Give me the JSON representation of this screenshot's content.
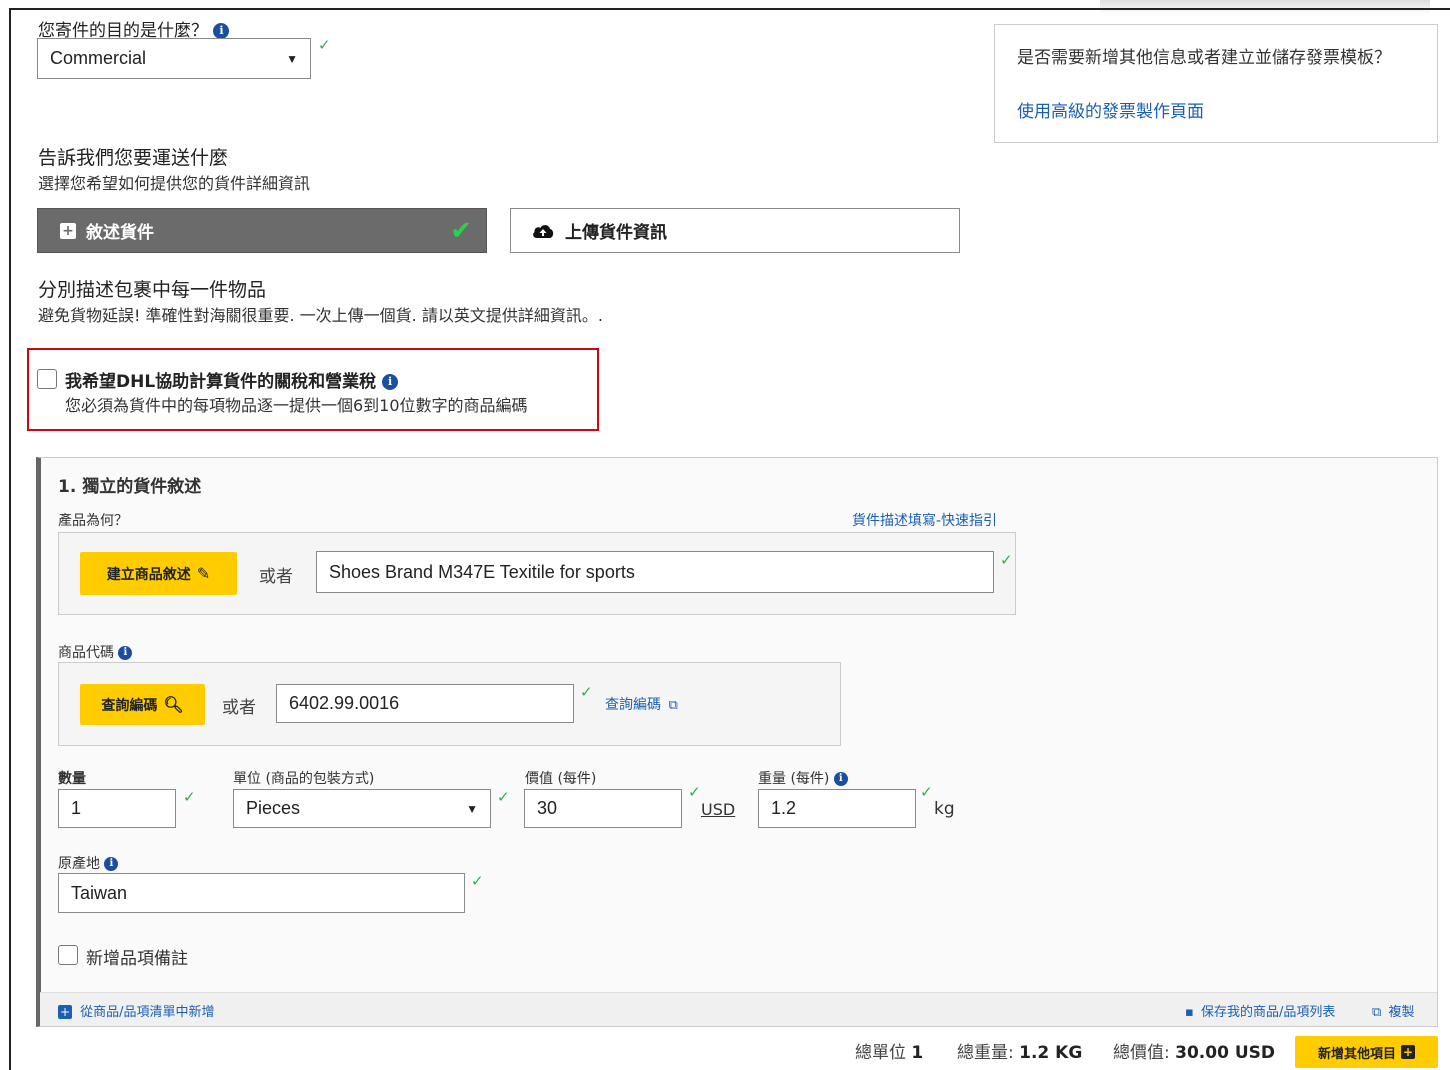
{
  "purpose": {
    "label": "您寄件的目的是什麼？",
    "value": "Commercial"
  },
  "side_box": {
    "text": "是否需要新增其他信息或者建立並儲存發票模板？",
    "link": "使用高級的發票製作頁面"
  },
  "shipment": {
    "title": "告訴我們您要運送什麼",
    "subtitle": "選擇您希望如何提供您的貨件詳細資訊",
    "describe_button": "敘述貨件",
    "upload_button": "上傳貨件資訊"
  },
  "items_intro": {
    "title": "分別描述包裹中每一件物品",
    "subtitle": "避免貨物延誤! 準確性對海關很重要. 一次上傳一個貨. 請以英文提供詳細資訊。."
  },
  "duty_option": {
    "label": "我希望DHL協助計算貨件的關稅和營業稅",
    "note": "您必須為貨件中的每項物品逐一提供一個6到10位數字的商品編碼",
    "highlight_color": "#d40511"
  },
  "item": {
    "heading": "1. 獨立的貨件敘述",
    "what_label": "產品為何？",
    "guide_link": "貨件描述填寫-快速指引",
    "build_button": "建立商品敘述",
    "or_text": "或者",
    "description_value": "Shoes Brand M347E Texitile for sports",
    "code_label": "商品代碼",
    "lookup_button": "查詢編碼",
    "code_value": "6402.99.0016",
    "lookup_link": "查詢編碼",
    "qty_label": "數量",
    "qty_value": "1",
    "unit_label": "單位 (商品的包裝方式)",
    "unit_value": "Pieces",
    "value_label": "價值 (每件)",
    "value_value": "30",
    "currency": "USD",
    "weight_label": "重量 (每件)",
    "weight_value": "1.2",
    "weight_unit": "kg",
    "origin_label": "原產地",
    "origin_value": "Taiwan",
    "note_checkbox": "新增品項備註",
    "add_from_list": "從商品/品項清單中新增",
    "save_list": "保存我的商品/品項列表",
    "copy": "複製"
  },
  "totals": {
    "units_label": "總單位",
    "units_value": "1",
    "weight_label": "總重量:",
    "weight_value": "1.2 KG",
    "value_label": "總價值:",
    "value_value": "30.00 USD",
    "add_item_button": "新增其他項目"
  },
  "colors": {
    "accent_yellow": "#ffcc00",
    "link_blue": "#1a5fb4",
    "check_green": "#2bb24c",
    "dark_button": "#6b6b6b"
  }
}
